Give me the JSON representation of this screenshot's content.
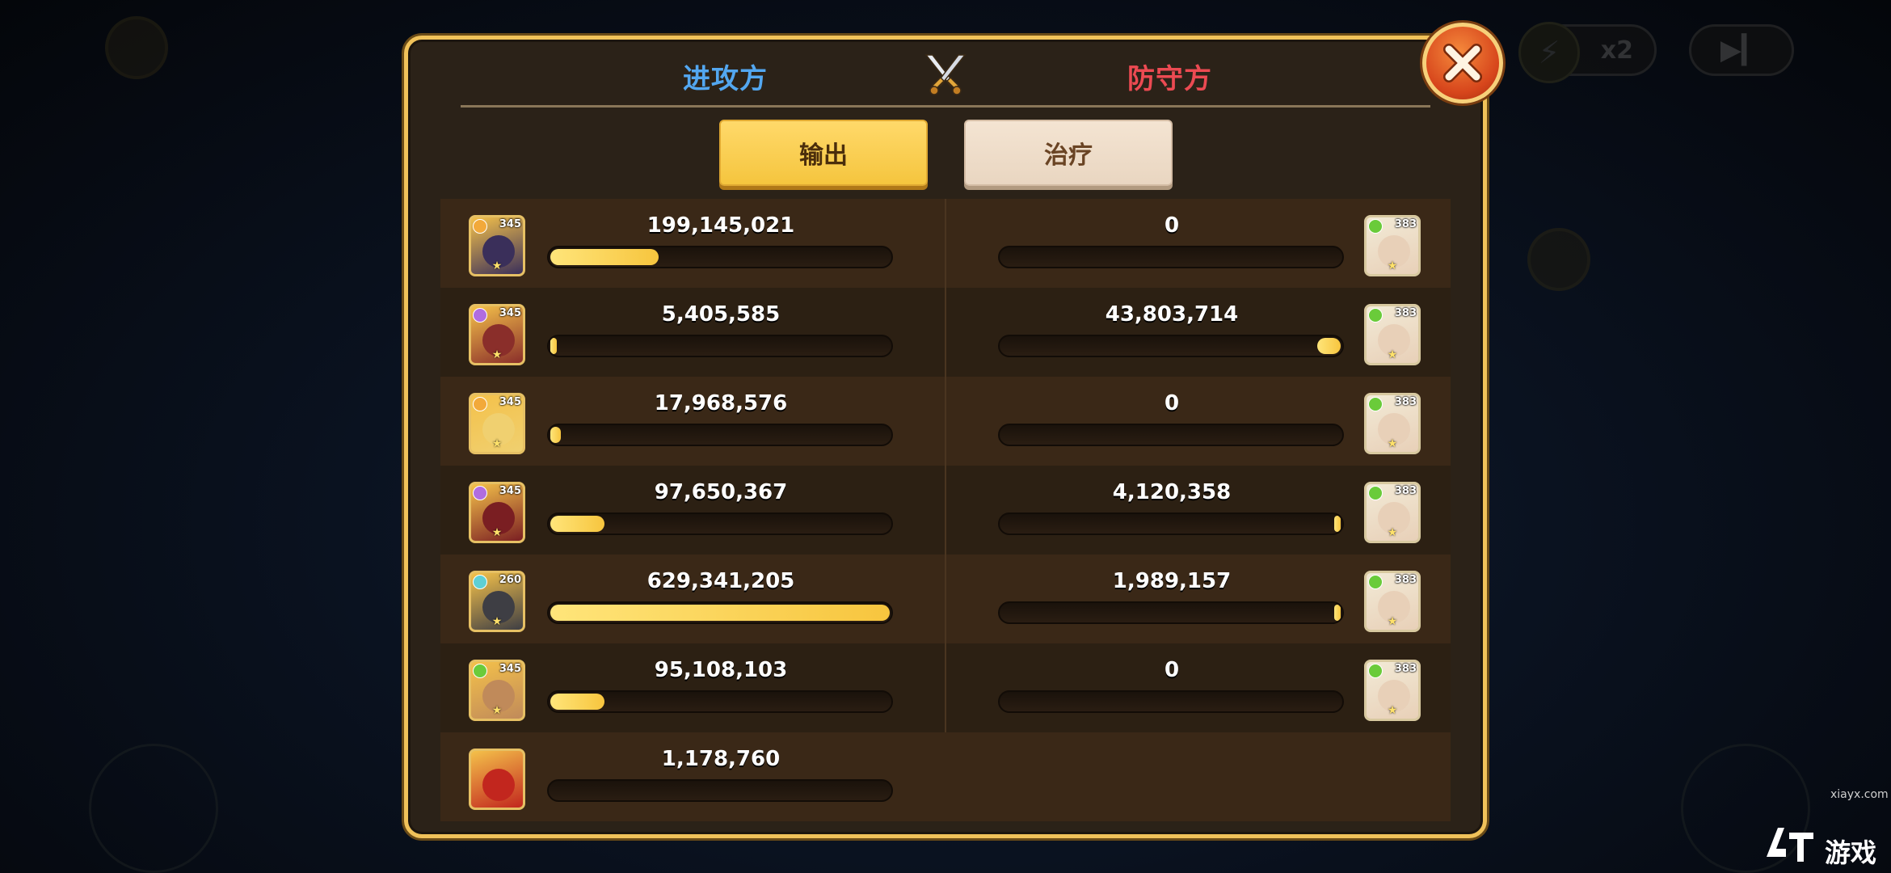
{
  "header": {
    "attacker_label": "进攻方",
    "defender_label": "防守方"
  },
  "tabs": [
    {
      "label": "输出",
      "active": true
    },
    {
      "label": "治疗",
      "active": false
    }
  ],
  "attackers": [
    {
      "level": "345",
      "value": "199,145,021",
      "fill": 0.32,
      "element_color": "#f2a93a",
      "face_color": "#3a2f5a"
    },
    {
      "level": "345",
      "value": "5,405,585",
      "fill": 0.01,
      "element_color": "#b06ce0",
      "face_color": "#8a2e2a"
    },
    {
      "level": "345",
      "value": "17,968,576",
      "fill": 0.03,
      "element_color": "#f2a93a",
      "face_color": "#f0d070"
    },
    {
      "level": "345",
      "value": "97,650,367",
      "fill": 0.16,
      "element_color": "#b06ce0",
      "face_color": "#7a1e22"
    },
    {
      "level": "260",
      "value": "629,341,205",
      "fill": 1.0,
      "element_color": "#5ecfd4",
      "face_color": "#3e3e44"
    },
    {
      "level": "345",
      "value": "95,108,103",
      "fill": 0.16,
      "element_color": "#6acb3a",
      "face_color": "#c08a5a"
    },
    {
      "level": "",
      "value": "1,178,760",
      "fill": 0.0,
      "element_color": "",
      "face_color": "#c2261e"
    }
  ],
  "defenders": [
    {
      "level": "383",
      "value": "0",
      "fill": 0.0,
      "element_color": "#6acb3a",
      "face_color": "#e8d0b8"
    },
    {
      "level": "383",
      "value": "43,803,714",
      "fill": 0.07,
      "element_color": "#6acb3a",
      "face_color": "#e8d0b8"
    },
    {
      "level": "383",
      "value": "0",
      "fill": 0.0,
      "element_color": "#6acb3a",
      "face_color": "#e8d0b8"
    },
    {
      "level": "383",
      "value": "4,120,358",
      "fill": 0.006,
      "element_color": "#6acb3a",
      "face_color": "#e8d0b8"
    },
    {
      "level": "383",
      "value": "1,989,157",
      "fill": 0.003,
      "element_color": "#6acb3a",
      "face_color": "#e8d0b8"
    },
    {
      "level": "383",
      "value": "0",
      "fill": 0.0,
      "element_color": "#6acb3a",
      "face_color": "#e8d0b8"
    }
  ],
  "background": {
    "speed_label": "x2"
  },
  "watermark": {
    "url": "xiayx.com",
    "text": "游戏"
  }
}
